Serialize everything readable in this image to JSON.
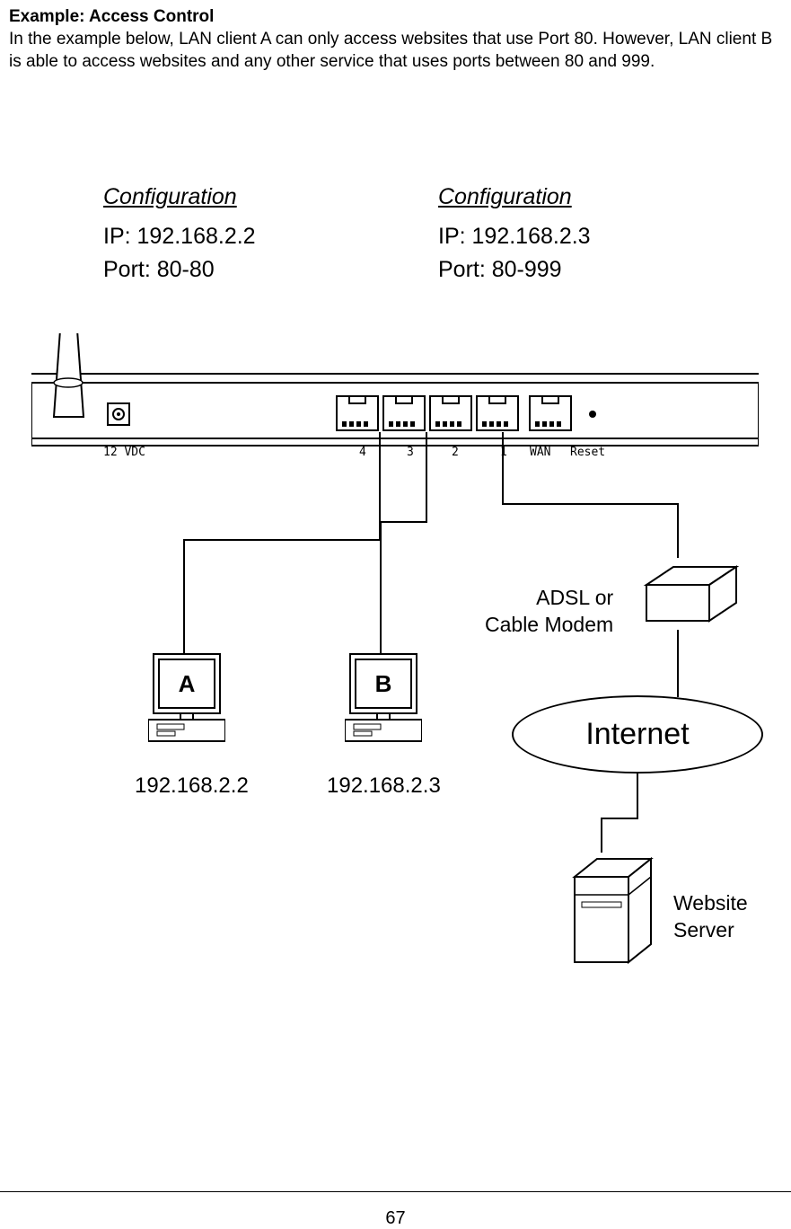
{
  "header": {
    "title": "Example: Access Control",
    "description": "In the example below, LAN client A can only access websites that use Port 80. However, LAN client B is able to access websites and any other service that uses ports between 80 and 999."
  },
  "config": {
    "a": {
      "label": "Configuration",
      "ip": "IP:  192.168.2.2",
      "port": "Port: 80-80"
    },
    "b": {
      "label": "Configuration",
      "ip": "IP:  192.168.2.3",
      "port": "Port: 80-999"
    }
  },
  "router": {
    "power_label": "12 VDC",
    "ports": {
      "p4": "4",
      "p3": "3",
      "p2": "2",
      "p1": "1",
      "wan": "WAN",
      "reset": "Reset"
    }
  },
  "clients": {
    "a": {
      "letter": "A",
      "ip": "192.168.2.2"
    },
    "b": {
      "letter": "B",
      "ip": "192.168.2.3"
    }
  },
  "modem": {
    "line1": "ADSL or",
    "line2": "Cable Modem"
  },
  "internet": "Internet",
  "server": {
    "line1": "Website",
    "line2": "Server"
  },
  "page_number": "67"
}
